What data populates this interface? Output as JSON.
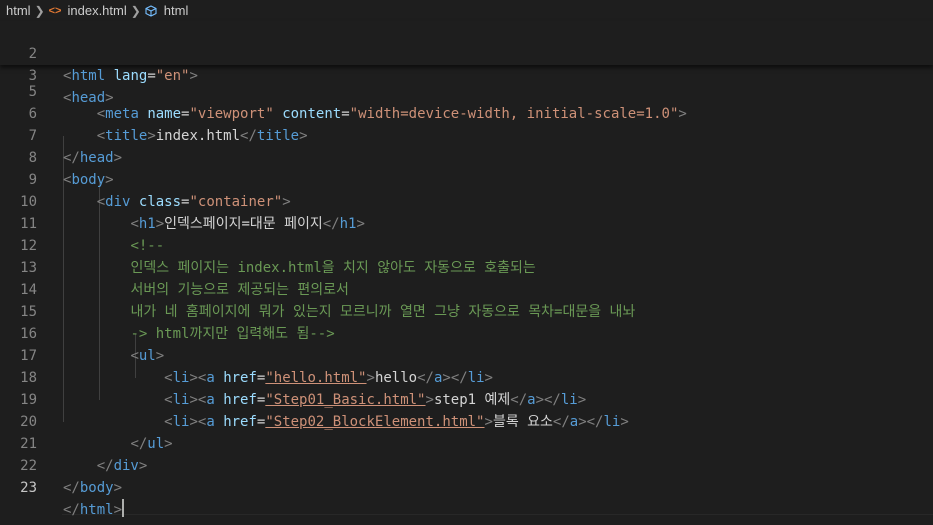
{
  "breadcrumb": {
    "folder": "html",
    "file": "index.html",
    "symbol": "html"
  },
  "icons": [
    "chevron-right-icon",
    "html-file-icon",
    "symbol-cube-icon"
  ],
  "colors": {
    "background": "#1e1e1e",
    "tag": "#569cd6",
    "attribute": "#9cdcfe",
    "string": "#ce9178",
    "comment": "#6a9955",
    "text": "#d4d4d4",
    "line_number": "#858585"
  },
  "sticky": [
    {
      "num": "2",
      "tag": "html",
      "attr": "lang",
      "value": "\"en\""
    },
    {
      "num": "3",
      "tag": "head"
    }
  ],
  "lines": {
    "l5": {
      "num": "5",
      "tag": "meta",
      "attr1": "name",
      "val1": "\"viewport\"",
      "attr2": "content",
      "val2": "\"width=device-width, initial-scale=1.0\""
    },
    "l6": {
      "num": "6",
      "tag": "title",
      "text": "index.html"
    },
    "l7": {
      "num": "7",
      "tag": "head"
    },
    "l8": {
      "num": "8",
      "tag": "body"
    },
    "l9": {
      "num": "9",
      "tag": "div",
      "attr": "class",
      "value": "\"container\""
    },
    "l10": {
      "num": "10",
      "tag": "h1",
      "text": "인덱스페이지=대문 페이지"
    },
    "l11": {
      "num": "11",
      "text": "<!--"
    },
    "l12": {
      "num": "12",
      "text": "인덱스 페이지는 index.html을 치지 않아도 자동으로 호출되는"
    },
    "l13": {
      "num": "13",
      "text": "서버의 기능으로 제공되는 편의로서"
    },
    "l14": {
      "num": "14",
      "text": "내가 네 홈페이지에 뭐가 있는지 모르니까 열면 그냥 자동으로 목차=대문을 내놔"
    },
    "l15": {
      "num": "15",
      "text": "-> html까지만 입력해도 됨-->"
    },
    "l16": {
      "num": "16",
      "tag": "ul"
    },
    "l17": {
      "num": "17",
      "href": "\"hello.html\"",
      "text": "hello"
    },
    "l18": {
      "num": "18",
      "href": "\"Step01_Basic.html\"",
      "text": "step1 예제"
    },
    "l19": {
      "num": "19",
      "href": "\"Step02_BlockElement.html\"",
      "text": "블록 요소"
    },
    "l20": {
      "num": "20",
      "tag": "ul"
    },
    "l21": {
      "num": "21",
      "tag": "div"
    },
    "l22": {
      "num": "22",
      "tag": "body"
    },
    "l23": {
      "num": "23",
      "tag": "html"
    }
  },
  "li_tag": "li",
  "a_tag": "a",
  "href_attr": "href"
}
